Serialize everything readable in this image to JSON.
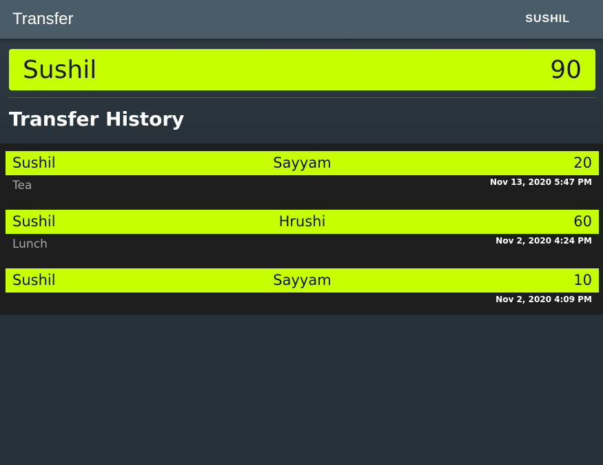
{
  "appbar": {
    "title": "Transfer",
    "action_label": "SUSHIL"
  },
  "balance": {
    "name": "Sushil",
    "amount": "90"
  },
  "history": {
    "title": "Transfer History",
    "items": [
      {
        "from": "Sushil",
        "to": "Sayyam",
        "amount": "20",
        "note": "Tea",
        "date": "Nov 13, 2020 5:47 PM"
      },
      {
        "from": "Sushil",
        "to": "Hrushi",
        "amount": "60",
        "note": "Lunch",
        "date": "Nov 2, 2020 4:24 PM"
      },
      {
        "from": "Sushil",
        "to": "Sayyam",
        "amount": "10",
        "note": "",
        "date": "Nov 2, 2020 4:09 PM"
      }
    ]
  },
  "colors": {
    "appbar": "#495c68",
    "accent": "#c6ff00",
    "background": "#27313a",
    "list_background": "#1e1e1e"
  }
}
